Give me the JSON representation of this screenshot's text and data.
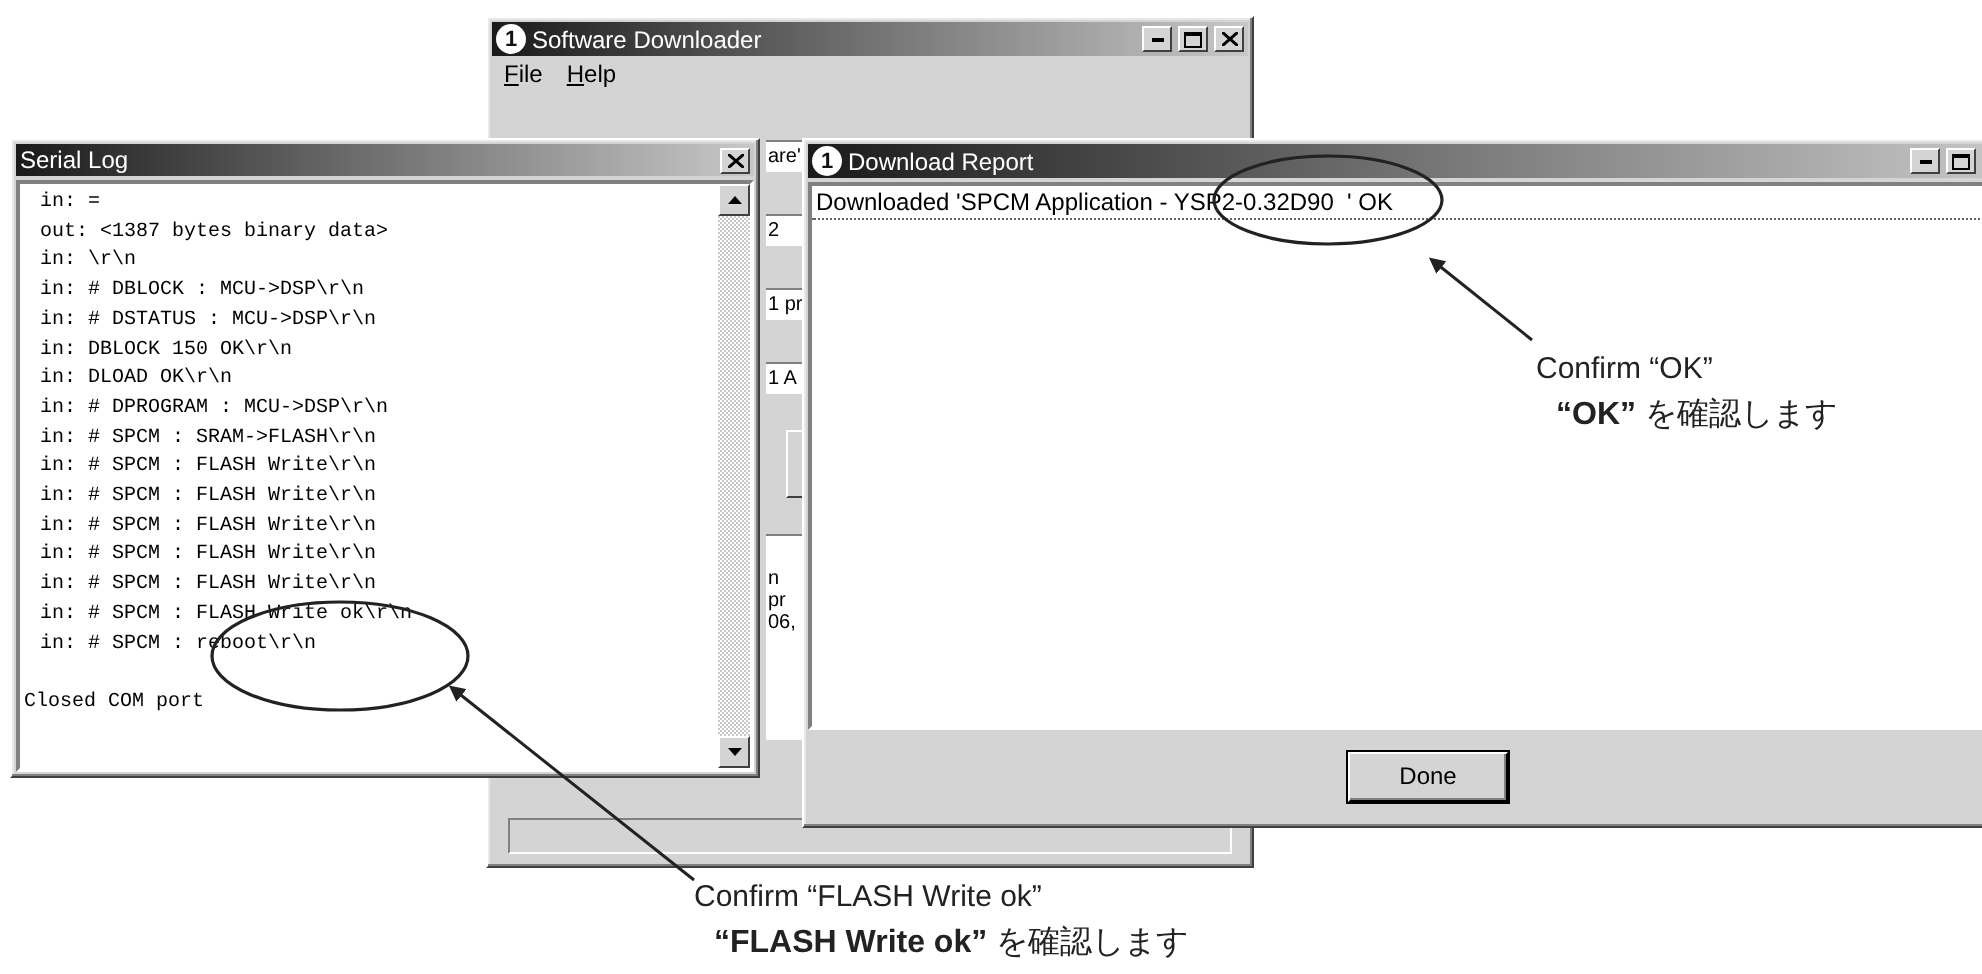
{
  "software_downloader": {
    "icon_glyph": "1",
    "title": "Software Downloader",
    "menu": [
      "File",
      "Help"
    ],
    "fields": [
      "are'",
      "2",
      "1 pr",
      "1 A"
    ],
    "list_lines": [
      "n",
      "pr",
      "06,"
    ]
  },
  "serial_log": {
    "title": "Serial Log",
    "lines": [
      "in: =",
      "out: <1387 bytes binary data>",
      "in: \\r\\n",
      "in: # DBLOCK : MCU->DSP\\r\\n",
      "in: # DSTATUS : MCU->DSP\\r\\n",
      "in: DBLOCK 150 OK\\r\\n",
      "in: DLOAD OK\\r\\n",
      "in: # DPROGRAM : MCU->DSP\\r\\n",
      "in: # SPCM : SRAM->FLASH\\r\\n",
      "in: # SPCM : FLASH Write\\r\\n",
      "in: # SPCM : FLASH Write\\r\\n",
      "in: # SPCM : FLASH Write\\r\\n",
      "in: # SPCM : FLASH Write\\r\\n",
      "in: # SPCM : FLASH Write\\r\\n",
      "in: # SPCM : FLASH Write ok\\r\\n",
      "in: # SPCM : reboot\\r\\n"
    ],
    "footer": "Closed COM port"
  },
  "download_report": {
    "icon_glyph": "1",
    "title": "Download Report",
    "rows": [
      "Downloaded 'SPCM Application - YSP2-0.32D90  ' OK"
    ],
    "button": "Done"
  },
  "annotations": [
    {
      "caption": "Confirm “FLASH Write ok”",
      "caption_jp": "**“FLASH Write ok”** を確認します"
    },
    {
      "caption": "Confirm “OK”",
      "caption_jp": "**“OK”** を確認します"
    }
  ]
}
